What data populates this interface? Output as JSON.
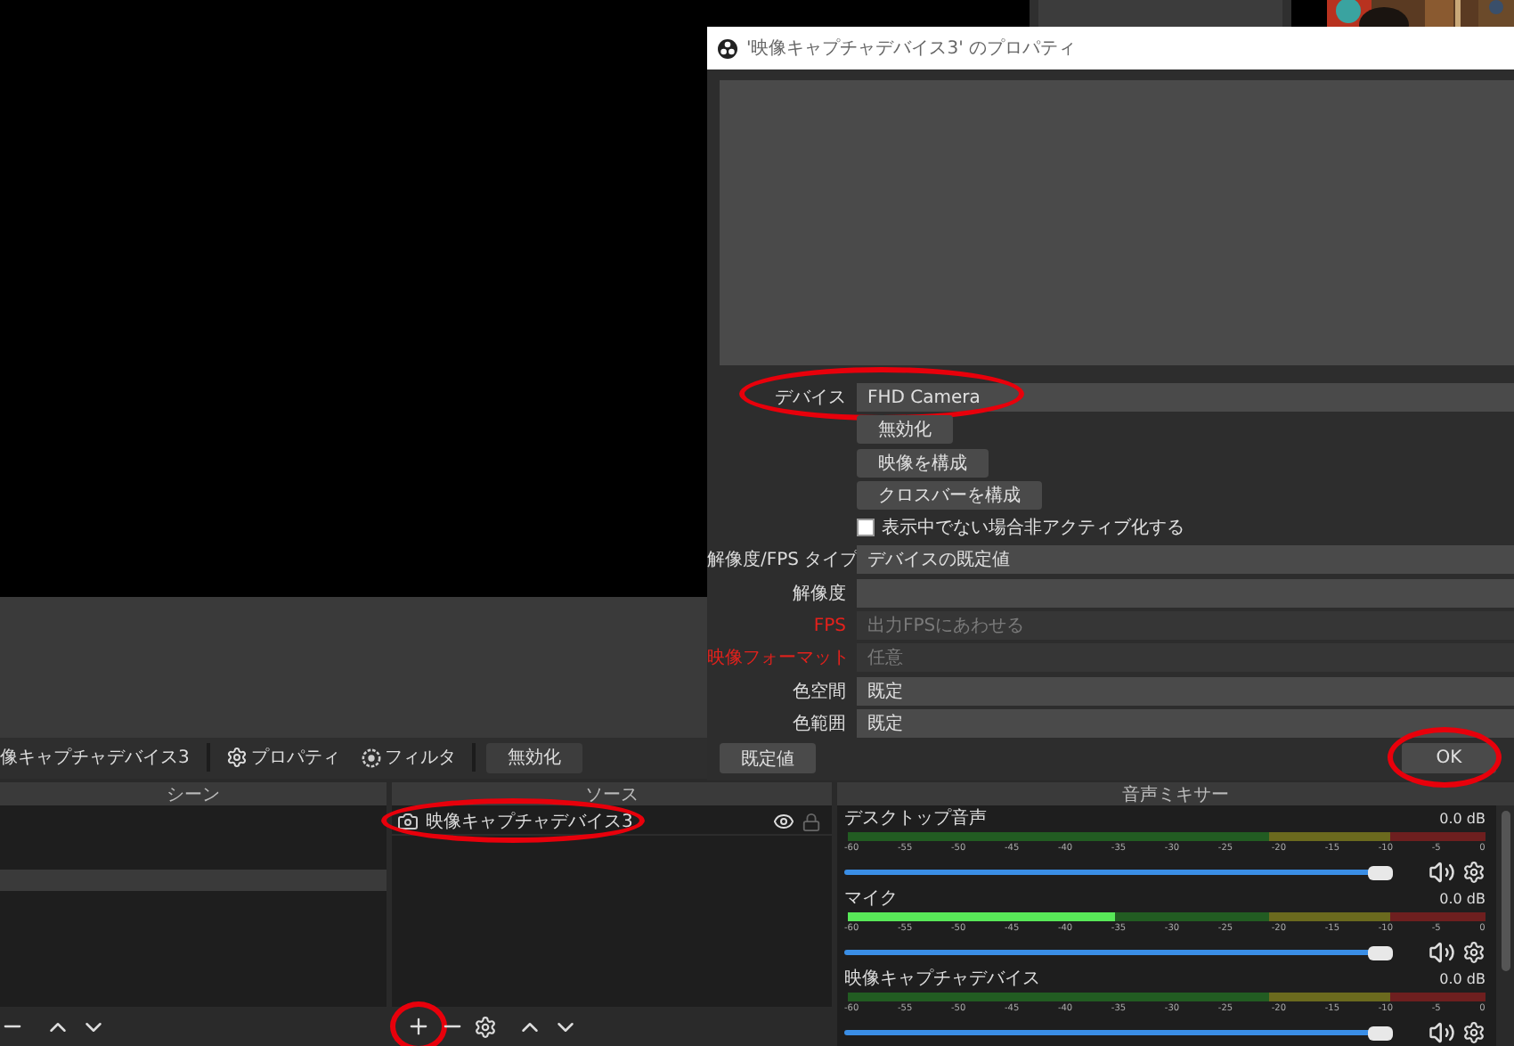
{
  "toolbar": {
    "source_name": "像キャプチャデバイス3",
    "actions": [
      {
        "kind": "gear",
        "label": "プロパティ"
      },
      {
        "kind": "filter",
        "label": "フィルタ"
      }
    ],
    "button": "無効化"
  },
  "scenes": {
    "title": "シーン",
    "rows": [
      {
        "selected": false
      },
      {
        "selected": false
      },
      {
        "selected": false
      },
      {
        "selected": true
      }
    ],
    "controls": [
      {
        "kind": "remove"
      },
      {
        "kind": "up"
      },
      {
        "kind": "down"
      }
    ]
  },
  "sources": {
    "title": "ソース",
    "items": [
      {
        "name": "映像キャプチャデバイス3",
        "visible": true,
        "locked": false,
        "annotated": true
      }
    ],
    "controls": [
      {
        "kind": "add",
        "annotated": true
      },
      {
        "kind": "remove"
      },
      {
        "kind": "settings"
      },
      {
        "kind": "up"
      },
      {
        "kind": "down"
      }
    ]
  },
  "mixer": {
    "title": "音声ミキサー",
    "channels": [
      {
        "name": "デスクトップ音声",
        "reading": "0.0 dB",
        "volume": {
          "level": 0.93
        },
        "scale": [
          "-60",
          "-55",
          "-50",
          "-45",
          "-40",
          "-35",
          "-30",
          "-25",
          "-20",
          "-15",
          "-10",
          "-5",
          "0"
        ]
      },
      {
        "name": "マイク",
        "reading": "0.0 dB",
        "meter": {
          "level": 0.42
        },
        "volume": {
          "level": 0.93
        },
        "scale": [
          "-60",
          "-55",
          "-50",
          "-45",
          "-40",
          "-35",
          "-30",
          "-25",
          "-20",
          "-15",
          "-10",
          "-5",
          "0"
        ]
      },
      {
        "name": "映像キャプチャデバイス",
        "reading": "0.0 dB",
        "volume": {
          "level": 0.93
        },
        "scale": [
          "-60",
          "-55",
          "-50",
          "-45",
          "-40",
          "-35",
          "-30",
          "-25",
          "-20",
          "-15",
          "-10",
          "-5",
          "0"
        ]
      }
    ]
  },
  "dialog": {
    "title": "'映像キャプチャデバイス3' のプロパティ",
    "fields": [
      {
        "kind": "select",
        "label": "デバイス",
        "value": "FHD Camera",
        "error": false,
        "disabled": false,
        "annotated": true
      },
      {
        "kind": "button",
        "label": "無効化"
      },
      {
        "kind": "button",
        "label": "映像を構成"
      },
      {
        "kind": "button",
        "label": "クロスバーを構成"
      },
      {
        "kind": "checkbox",
        "label": "表示中でない場合非アクティブ化する",
        "checked": false
      },
      {
        "kind": "select",
        "label": "解像度/FPS タイプ",
        "value": "デバイスの既定値",
        "error": false,
        "disabled": false
      },
      {
        "kind": "select",
        "label": "解像度",
        "error": false,
        "disabled": false
      },
      {
        "kind": "select",
        "label": "FPS",
        "value": "出力FPSにあわせる",
        "error": true,
        "disabled": true
      },
      {
        "kind": "select",
        "label": "映像フォーマット",
        "value": "任意",
        "error": true,
        "disabled": true
      },
      {
        "kind": "select",
        "label": "色空間",
        "value": "既定",
        "error": false,
        "disabled": false
      },
      {
        "kind": "select",
        "label": "色範囲",
        "value": "既定",
        "error": false,
        "disabled": false
      }
    ],
    "defaults_button": {
      "label": "既定値"
    },
    "ok_button": {
      "label": "OK",
      "annotated": true
    }
  }
}
